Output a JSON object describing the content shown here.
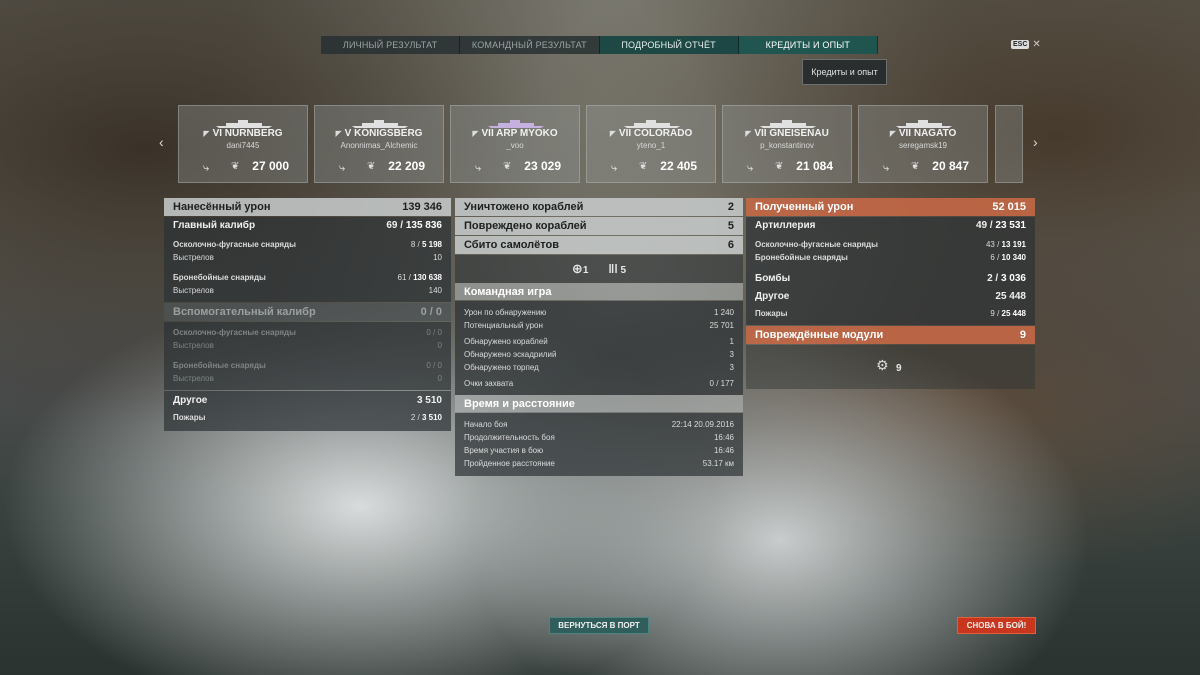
{
  "tabs": [
    "ЛИЧНЫЙ РЕЗУЛЬТАТ",
    "КОМАНДНЫЙ РЕЗУЛЬТАТ",
    "ПОДРОБНЫЙ ОТЧЁТ",
    "КРЕДИТЫ И ОПЫТ"
  ],
  "tooltip": "Кредиты и опыт",
  "esc": "ESC",
  "ships": [
    {
      "name": "VI NÜRNBERG",
      "player": "dani7445",
      "score": "27 000"
    },
    {
      "name": "V KÖNIGSBERG",
      "player": "Anonnimas_Alchemic",
      "score": "22 209"
    },
    {
      "name": "VII ARP MYOKO",
      "player": "_voo",
      "score": "23 029"
    },
    {
      "name": "VII COLORADO",
      "player": "yteno_1",
      "score": "22 405"
    },
    {
      "name": "VII GNEISENAU",
      "player": "p_konstantinov",
      "score": "21 084"
    },
    {
      "name": "VII NAGATO",
      "player": "seregamsk19",
      "score": "20 847"
    }
  ],
  "left": {
    "dealt_label": "Нанесённый урон",
    "dealt_value": "139 346",
    "main_label": "Главный калибр",
    "main_hits": "69",
    "main_total": "135 836",
    "he_label": "Осколочно-фугасные снаряды",
    "he_hits": "8",
    "he_total": "5 198",
    "he_shots_label": "Выстрелов",
    "he_shots": "10",
    "ap_label": "Бронебойные снаряды",
    "ap_hits": "61",
    "ap_total": "130 638",
    "ap_shots_label": "Выстрелов",
    "ap_shots": "140",
    "sec_label": "Вспомогательный калибр",
    "sec_value": "0 / 0",
    "sec_he_label": "Осколочно-фугасные снаряды",
    "sec_he_value": "0 / 0",
    "sec_he_shots_label": "Выстрелов",
    "sec_he_shots": "0",
    "sec_ap_label": "Бронебойные снаряды",
    "sec_ap_value": "0 / 0",
    "sec_ap_shots_label": "Выстрелов",
    "sec_ap_shots": "0",
    "other_label": "Другое",
    "other_value": "3 510",
    "fires_label": "Пожары",
    "fires_hits": "2",
    "fires_total": "3 510"
  },
  "middle": {
    "destroyed_label": "Уничтожено кораблей",
    "destroyed_value": "2",
    "damaged_label": "Повреждено кораблей",
    "damaged_value": "5",
    "planes_label": "Сбито самолётов",
    "planes_value": "6",
    "icon_count_1": "1",
    "icon_count_2": "5",
    "team_title": "Командная игра",
    "spot_dmg_label": "Урон по обнаружению",
    "spot_dmg_value": "1 240",
    "pot_dmg_label": "Потенциальный урон",
    "pot_dmg_value": "25 701",
    "spot_ships_label": "Обнаружено кораблей",
    "spot_ships_value": "1",
    "spot_sq_label": "Обнаружено эскадрилий",
    "spot_sq_value": "3",
    "spot_torp_label": "Обнаружено торпед",
    "spot_torp_value": "3",
    "cap_label": "Очки захвата",
    "cap_value": "0 / 177",
    "time_title": "Время и расстояние",
    "start_label": "Начало боя",
    "start_value": "22:14  20.09.2016",
    "dur_label": "Продолжительность боя",
    "dur_value": "16:46",
    "part_label": "Время участия в бою",
    "part_value": "16:46",
    "dist_label": "Пройденное расстояние",
    "dist_value": "53.17 км"
  },
  "right": {
    "recv_label": "Полученный урон",
    "recv_value": "52 015",
    "art_label": "Артиллерия",
    "art_hits": "49",
    "art_total": "23 531",
    "he_label": "Осколочно-фугасные снаряды",
    "he_hits": "43",
    "he_total": "13 191",
    "ap_label": "Бронебойные снаряды",
    "ap_hits": "6",
    "ap_total": "10 340",
    "bombs_label": "Бомбы",
    "bombs_hits": "2",
    "bombs_total": "3 036",
    "other_label": "Другое",
    "other_value": "25 448",
    "fires_label": "Пожары",
    "fires_hits": "9",
    "fires_total": "25 448",
    "modules_label": "Повреждённые модули",
    "modules_value": "9",
    "module_icon_count": "9"
  },
  "buttons": {
    "port": "ВЕРНУТЬСЯ В ПОРТ",
    "battle": "СНОВА В БОЙ!"
  }
}
